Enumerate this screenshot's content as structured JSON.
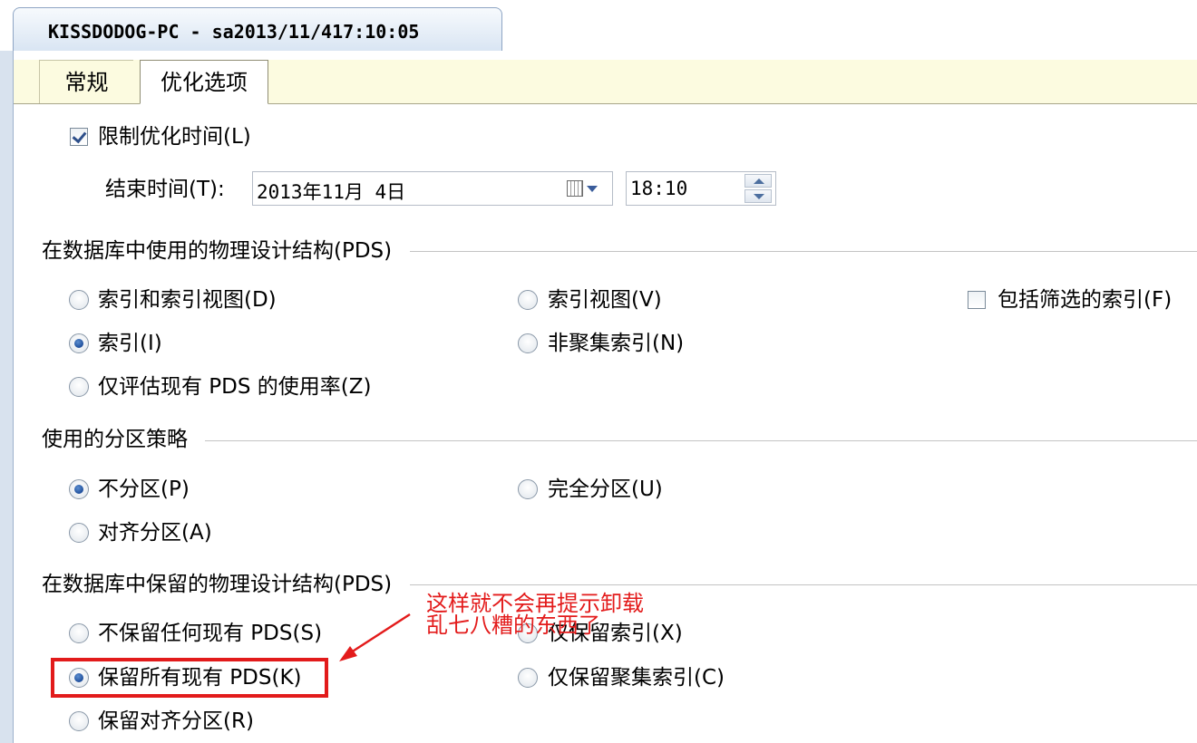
{
  "window": {
    "tab_title": "KISSDODOG-PC - sa2013/11/417:10:05"
  },
  "tabs": [
    {
      "label": "常规",
      "active": false
    },
    {
      "label": "优化选项",
      "active": true
    }
  ],
  "limit_time": {
    "label": "限制优化时间(L)",
    "checked": true
  },
  "end_time": {
    "label": "结束时间(T):",
    "date_value": "2013年11月 4日",
    "time_value": "18:10"
  },
  "pds_use": {
    "title": "在数据库中使用的物理设计结构(PDS)",
    "options": [
      {
        "label": "索引和索引视图(D)",
        "selected": false
      },
      {
        "label": "索引视图(V)",
        "selected": false
      },
      {
        "label": "索引(I)",
        "selected": true
      },
      {
        "label": "非聚集索引(N)",
        "selected": false
      },
      {
        "label": "仅评估现有 PDS 的使用率(Z)",
        "selected": false
      }
    ],
    "include_filtered": {
      "label": "包括筛选的索引(F)",
      "checked": false
    }
  },
  "partition": {
    "title": "使用的分区策略",
    "options": [
      {
        "label": "不分区(P)",
        "selected": true
      },
      {
        "label": "完全分区(U)",
        "selected": false
      },
      {
        "label": "对齐分区(A)",
        "selected": false
      }
    ]
  },
  "pds_keep": {
    "title": "在数据库中保留的物理设计结构(PDS)",
    "options": [
      {
        "label": "不保留任何现有 PDS(S)",
        "selected": false
      },
      {
        "label": "仅保留索引(X)",
        "selected": false
      },
      {
        "label": "保留所有现有 PDS(K)",
        "selected": true
      },
      {
        "label": "仅保留聚集索引(C)",
        "selected": false
      },
      {
        "label": "保留对齐分区(R)",
        "selected": false
      }
    ]
  },
  "annotation": {
    "line1": "这样就不会再提示卸载",
    "line2": "乱七八糟的东西了",
    "color": "#e31b1b"
  }
}
